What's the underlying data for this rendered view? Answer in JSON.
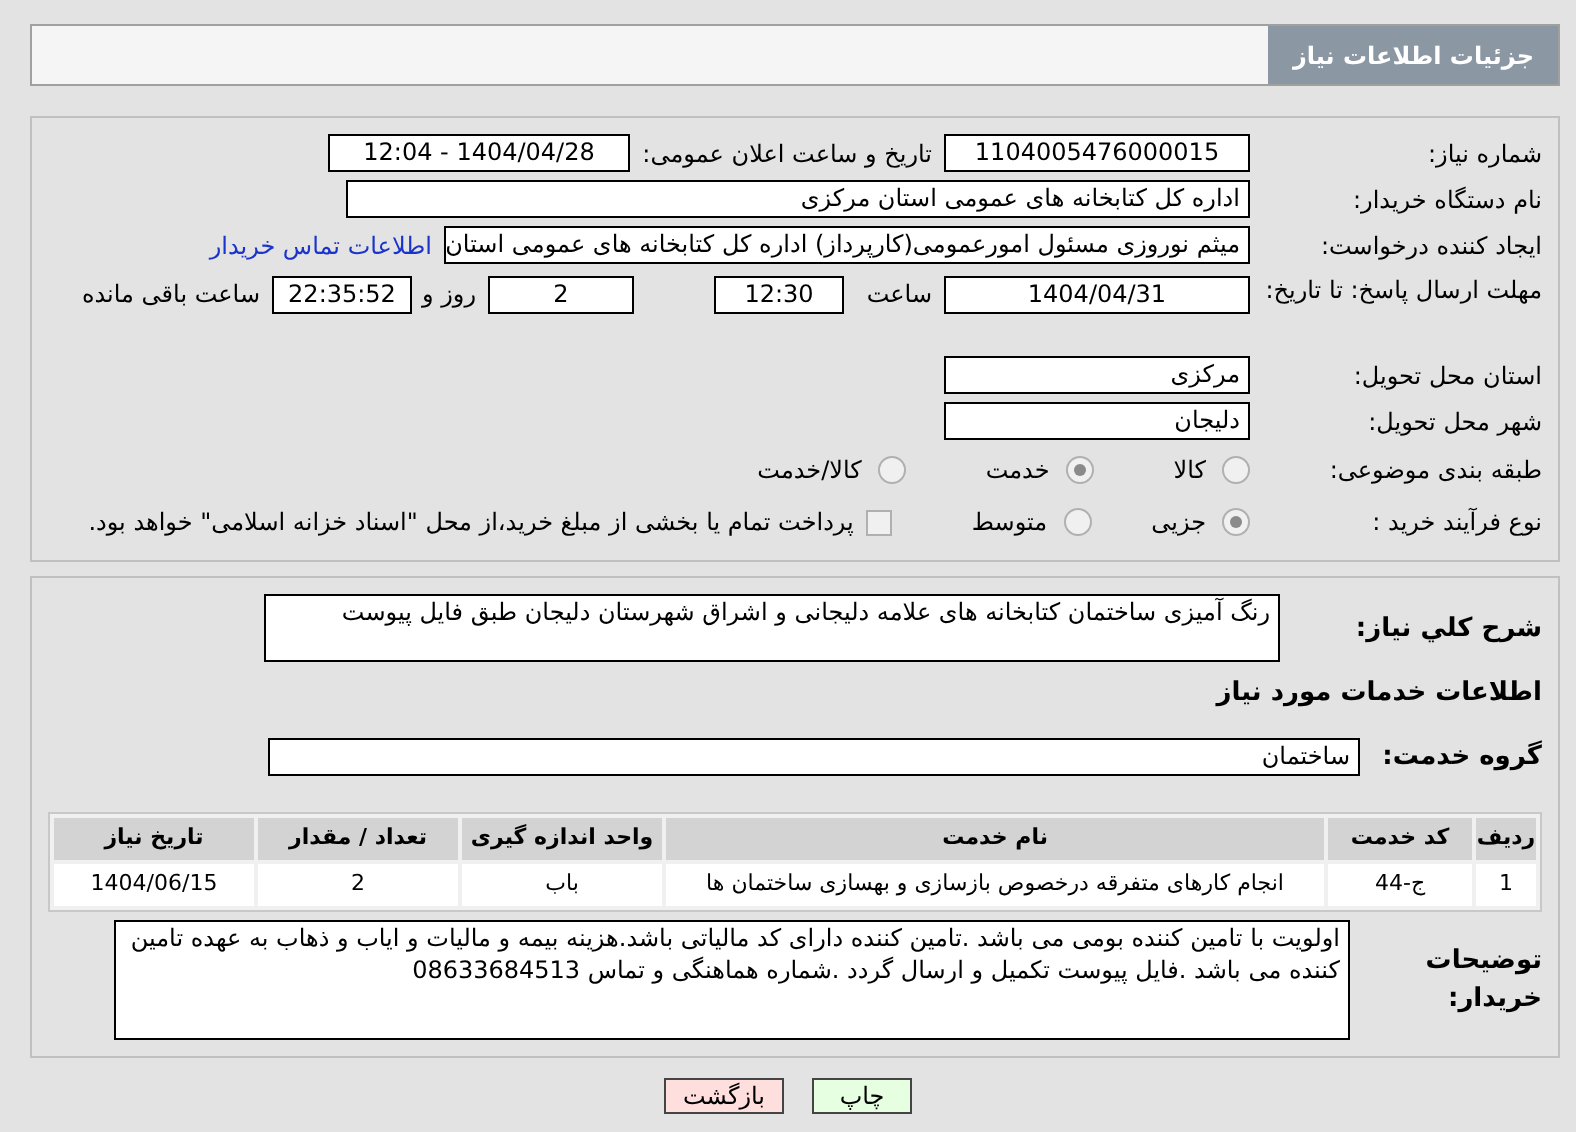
{
  "header": {
    "title": "جزئیات اطلاعات نیاز"
  },
  "details": {
    "need_number": {
      "label": "شماره نیاز:",
      "value": "1104005476000015"
    },
    "announce": {
      "label": "تاریخ و ساعت اعلان عمومی:",
      "value": "1404/04/28 - 12:04"
    },
    "buyer": {
      "label": "نام دستگاه خریدار:",
      "value": "اداره کل کتابخانه های عمومی استان مرکزی"
    },
    "creator": {
      "label": "ایجاد کننده درخواست:",
      "value": "میثم نوروزی مسئول امورعمومی(کارپرداز) اداره کل کتابخانه های عمومی استان",
      "link": "اطلاعات تماس خریدار"
    },
    "deadline": {
      "label": "مهلت ارسال پاسخ: تا تاریخ:",
      "date": "1404/04/31",
      "time_label": "ساعت",
      "time": "12:30",
      "days": "2",
      "days_label": "روز و",
      "remaining": "22:35:52",
      "remaining_label": "ساعت باقی مانده"
    },
    "province": {
      "label": "استان محل تحویل:",
      "value": "مرکزی"
    },
    "city": {
      "label": "شهر محل تحویل:",
      "value": "دلیجان"
    },
    "category": {
      "label": "طبقه بندی موضوعی:",
      "options": [
        {
          "label": "کالا",
          "selected": false
        },
        {
          "label": "خدمت",
          "selected": true
        },
        {
          "label": "کالا/خدمت",
          "selected": false
        }
      ]
    },
    "process": {
      "label": "نوع فرآیند خرید :",
      "options": [
        {
          "label": "جزیی",
          "selected": true
        },
        {
          "label": "متوسط",
          "selected": false
        }
      ],
      "treasury": {
        "label": "پرداخت تمام یا بخشی از مبلغ خرید،از محل \"اسناد خزانه اسلامی\" خواهد بود.",
        "checked": false
      }
    }
  },
  "services": {
    "description": {
      "label": "شرح کلي نياز:",
      "value": "رنگ آمیزی ساختمان کتابخانه های علامه دلیجانی و اشراق شهرستان دلیجان طبق فایل پیوست"
    },
    "heading": "اطلاعات خدمات مورد نیاز",
    "group": {
      "label": "گروه خدمت:",
      "value": "ساختمان"
    },
    "table": {
      "columns": [
        "ردیف",
        "کد خدمت",
        "نام خدمت",
        "واحد اندازه گیری",
        "تعداد / مقدار",
        "تاریخ نیاز"
      ],
      "rows": [
        [
          "1",
          "ج-44",
          "انجام کارهای متفرقه درخصوص بازسازی و بهسازی ساختمان ها",
          "باب",
          "2",
          "1404/06/15"
        ]
      ]
    },
    "notes": {
      "label": "توضیحات خریدار:",
      "value": "اولویت با تامین کننده بومی می باشد .تامین کننده دارای کد مالیاتی باشد.هزینه بیمه و مالیات و ایاب و ذهاب به عهده تامین کننده می باشد .فایل پیوست تکمیل و ارسال گردد .شماره هماهنگی و تماس 08633684513"
    }
  },
  "buttons": {
    "print": "چاپ",
    "back": "بازگشت"
  }
}
